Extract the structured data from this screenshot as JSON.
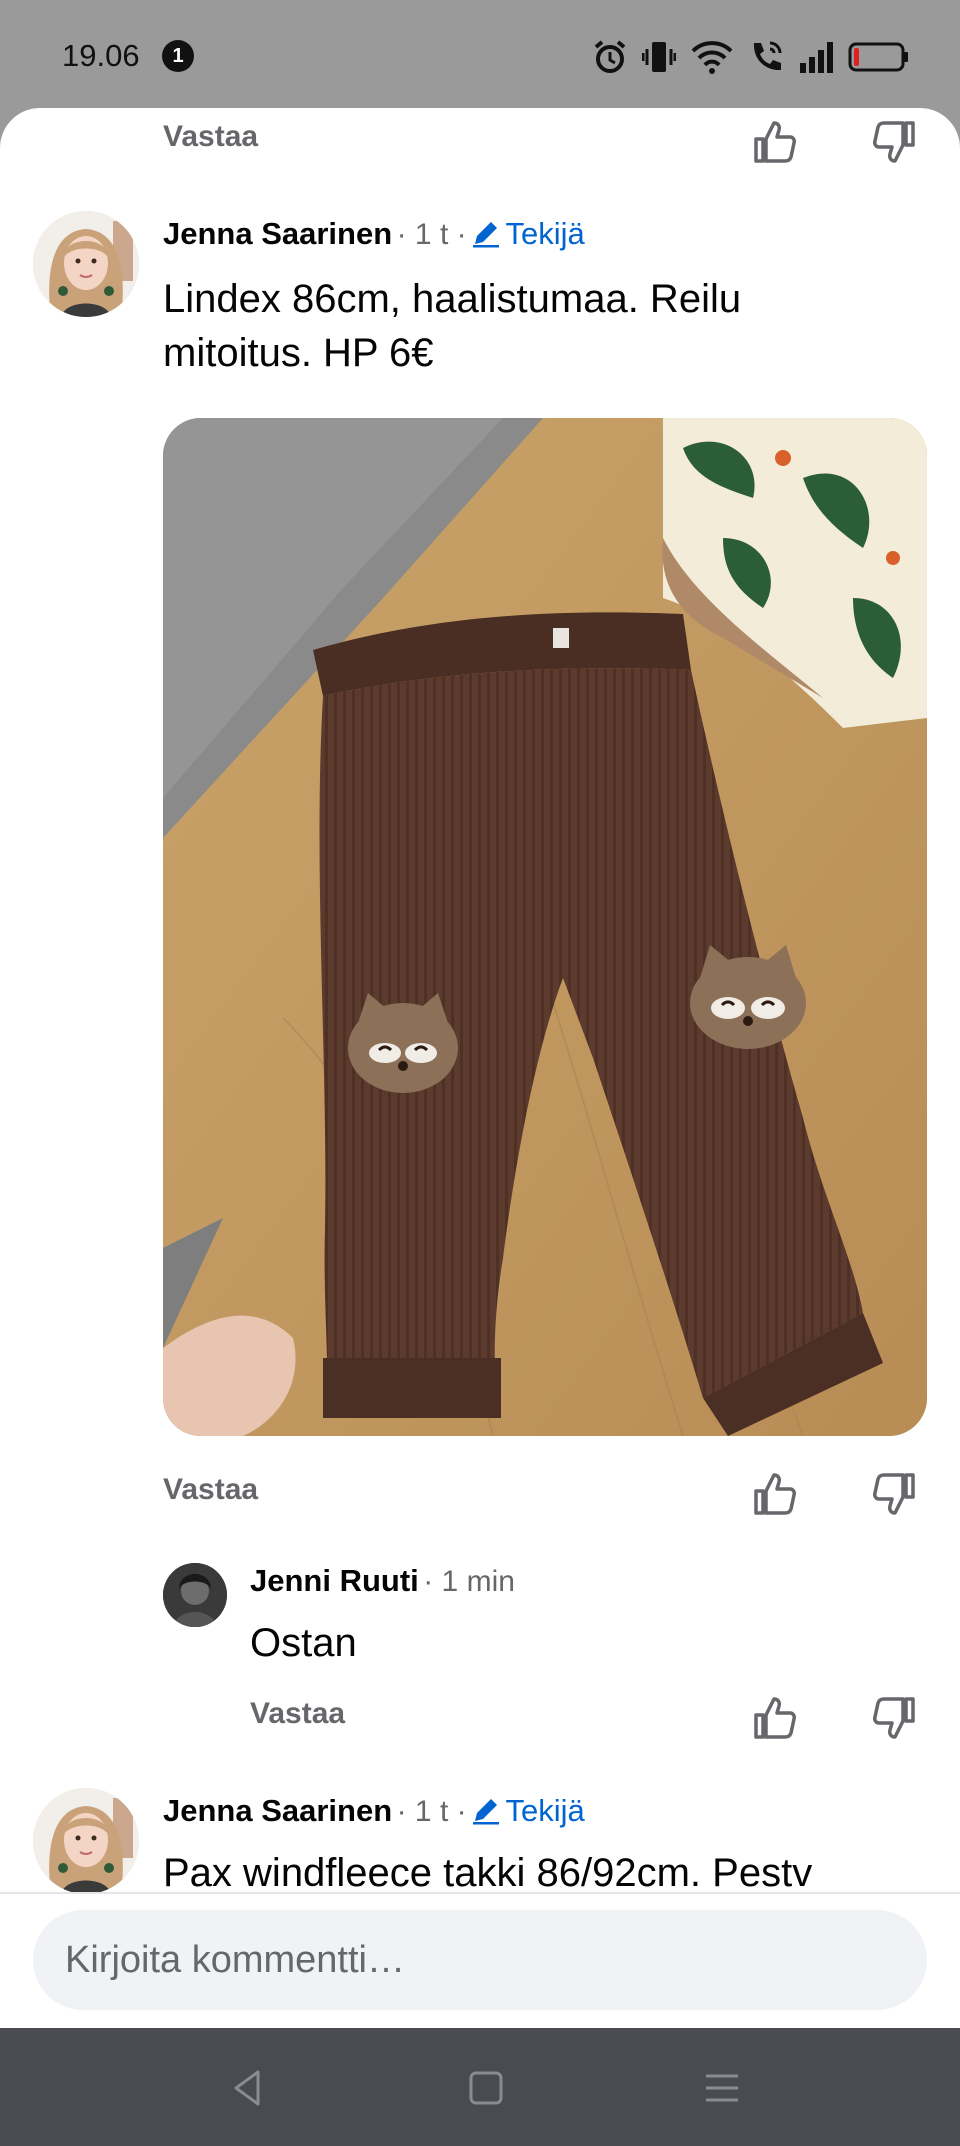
{
  "status_bar": {
    "time": "19.06",
    "notification_count": "1",
    "icons": [
      "alarm-icon",
      "vibrate-icon",
      "wifi-icon",
      "wifi-calling-icon",
      "signal-icon",
      "battery-low-icon"
    ]
  },
  "comments_top": {
    "reply_label": "Vastaa"
  },
  "comment_1": {
    "author": "Jenna Saarinen",
    "time": "· 1 t ·",
    "author_badge": "Tekijä",
    "text": "Lindex 86cm, haalistumaa. Reilu mitoitus. HP 6€",
    "reply_label": "Vastaa",
    "photo": "brown-ribbed-toddler-pants-with-raccoon-knee-patches"
  },
  "reply_1": {
    "author": "Jenni Ruuti",
    "time": "· 1 min",
    "text": "Ostan",
    "reply_label": "Vastaa"
  },
  "comment_2": {
    "author": "Jenna Saarinen",
    "time": "· 1 t ·",
    "author_badge": "Tekijä",
    "text": "Pax windfleece takki 86/92cm. Pestv"
  },
  "composer": {
    "placeholder": "Kirjoita kommentti…"
  },
  "colors": {
    "link_blue": "#0064d1",
    "muted_gray": "#65676b",
    "nav_bar": "#4a4b50",
    "status_bar": "#9a9a9a"
  }
}
